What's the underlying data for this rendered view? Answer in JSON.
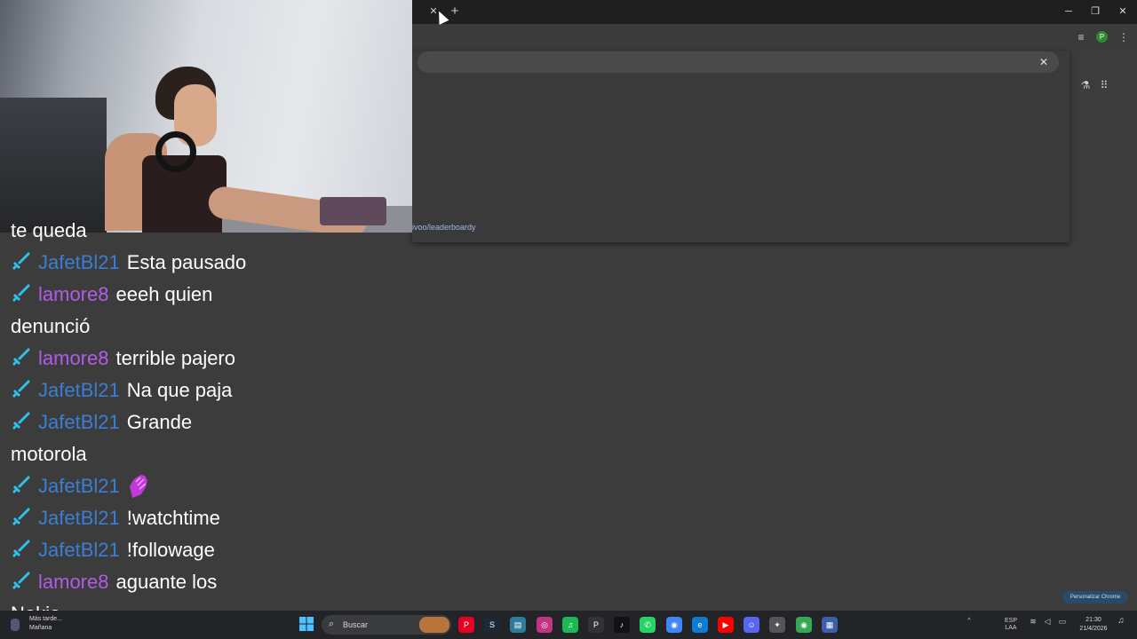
{
  "browser": {
    "tab_close_symbol": "✕",
    "new_tab_symbol": "+",
    "window_controls": {
      "minimize": "─",
      "maximize": "❐",
      "close": "✕"
    },
    "profile_letter": "P",
    "omnibox_close_symbol": "✕",
    "panel_url_fragment": "ivoo/leaderboardy"
  },
  "chat": {
    "truncated_top_line": "te queda",
    "messages": [
      {
        "user": "JafetBl21",
        "user_color": "#3a7fd4",
        "text": "Esta pausado"
      },
      {
        "user": "lamore8",
        "user_color": "#b15ce8",
        "text": "eeeh quien",
        "continuation": "denunció"
      },
      {
        "user": "lamore8",
        "user_color": "#b15ce8",
        "text": "terrible pajero"
      },
      {
        "user": "JafetBl21",
        "user_color": "#3a7fd4",
        "text": "Na que paja"
      },
      {
        "user": "JafetBl21",
        "user_color": "#3a7fd4",
        "text": "Grande",
        "continuation": "motorola"
      },
      {
        "user": "JafetBl21",
        "user_color": "#3a7fd4",
        "emote": "purple-hand-emote"
      },
      {
        "user": "JafetBl21",
        "user_color": "#3a7fd4",
        "text": "!watchtime"
      },
      {
        "user": "JafetBl21",
        "user_color": "#3a7fd4",
        "text": "!followage"
      },
      {
        "user": "lamore8",
        "user_color": "#b15ce8",
        "text": "aguante los",
        "continuation": "Nokia"
      }
    ]
  },
  "customize_chip": "Personalizar Chrome",
  "taskbar": {
    "weather_line1": "Más tarde...",
    "weather_line2": "Mañana",
    "search_placeholder": "Buscar",
    "apps": [
      {
        "icon": "pinterest-icon",
        "label": "P",
        "color": "#e60023"
      },
      {
        "icon": "steam-icon",
        "label": "S",
        "color": "#1b2838"
      },
      {
        "icon": "files-icon",
        "label": "▤",
        "color": "#2d7d9a"
      },
      {
        "icon": "instagram-icon",
        "label": "◎",
        "color": "#c13584"
      },
      {
        "icon": "spotify-icon",
        "label": "♫",
        "color": "#1db954"
      },
      {
        "icon": "picsart-icon",
        "label": "P",
        "color": "#333333"
      },
      {
        "icon": "tiktok-icon",
        "label": "♪",
        "color": "#111111"
      },
      {
        "icon": "whatsapp-icon",
        "label": "✆",
        "color": "#25d366"
      },
      {
        "icon": "chrome-icon",
        "label": "◉",
        "color": "#4285f4"
      },
      {
        "icon": "edge-icon",
        "label": "e",
        "color": "#0c7bd6"
      },
      {
        "icon": "youtube-icon",
        "label": "▶",
        "color": "#ff0000"
      },
      {
        "icon": "discord-icon",
        "label": "☺",
        "color": "#5865f2"
      },
      {
        "icon": "game-icon",
        "label": "✦",
        "color": "#555555"
      },
      {
        "icon": "chrome-alt-icon",
        "label": "◉",
        "color": "#34a853"
      },
      {
        "icon": "app-icon",
        "label": "▦",
        "color": "#3b5fa8"
      }
    ],
    "language_line1": "ESP",
    "language_line2": "LAA",
    "time": "21:30",
    "date": "21/4/2026"
  }
}
